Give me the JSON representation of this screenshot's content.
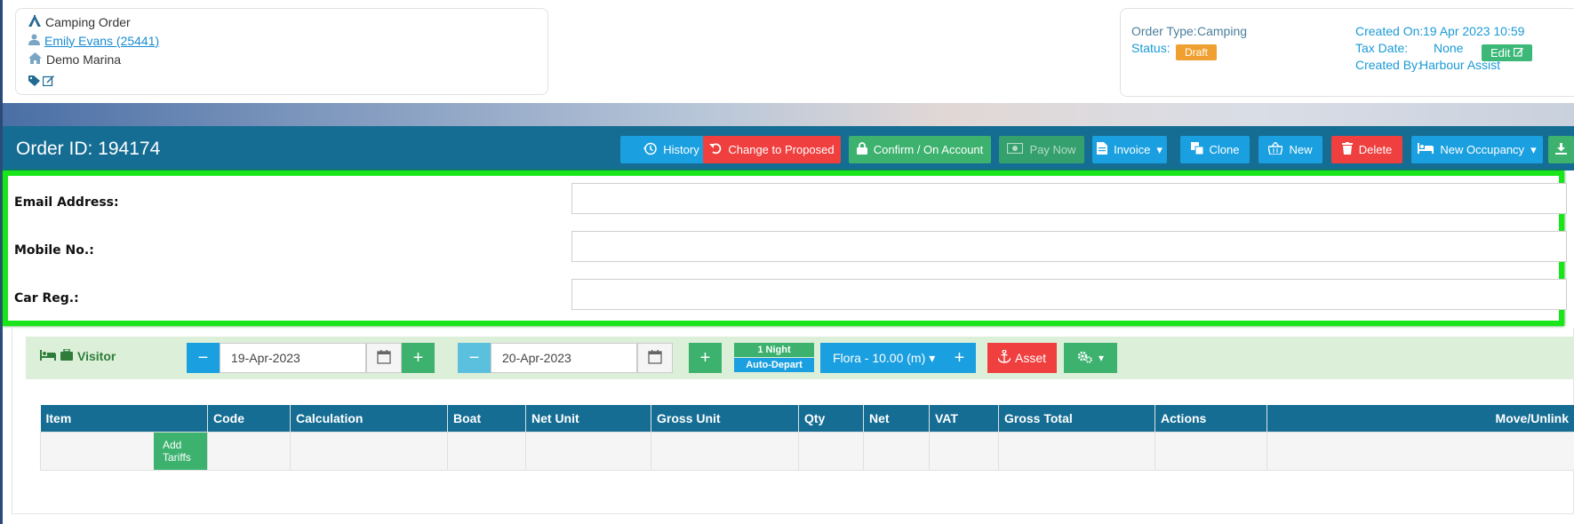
{
  "top_left": {
    "title": "Camping Order",
    "customer": "Emily Evans (25441)",
    "location": "Demo Marina"
  },
  "top_right": {
    "order_type_label": "Order Type:",
    "order_type_value": "Camping",
    "status_label": "Status:",
    "status_value": "Draft",
    "created_on_label": "Created On:",
    "created_on_value": "19 Apr 2023 10:59",
    "tax_date_label": "Tax Date:",
    "tax_date_value": "None",
    "edit_label": "Edit",
    "created_by_label": "Created By:",
    "created_by_value": "Harbour Assist"
  },
  "header": {
    "order_id": "Order ID: 194174",
    "buttons": {
      "history": "History",
      "change_to_proposed": "Change to Proposed",
      "confirm": "Confirm / On Account",
      "pay_now": "Pay Now",
      "invoice": "Invoice",
      "clone": "Clone",
      "new": "New",
      "delete": "Delete",
      "new_occupancy": "New Occupancy"
    }
  },
  "form": {
    "email_label": "Email Address:",
    "email_value": "",
    "mobile_label": "Mobile No.:",
    "mobile_value": "",
    "car_label": "Car Reg.:",
    "car_value": ""
  },
  "visitor": {
    "label": "Visitor",
    "arrival": "19-Apr-2023",
    "departure": "20-Apr-2023",
    "nights": "1 Night",
    "auto_depart": "Auto-Depart",
    "berth": "Flora - 10.00 (m)",
    "asset": "Asset"
  },
  "table": {
    "columns": [
      "Item",
      "Code",
      "Calculation",
      "Boat",
      "Net Unit",
      "Gross Unit",
      "Qty",
      "Net",
      "VAT",
      "Gross Total",
      "Actions",
      "Move/Unlink"
    ],
    "add_tariffs": "Add Tariffs"
  },
  "colors": {
    "header_bg": "#156d94",
    "highlight": "#19e51b",
    "primary_blue": "#1aa0e0",
    "danger": "#ef3f3f",
    "success": "#3cb26e",
    "warning": "#f0a030"
  }
}
